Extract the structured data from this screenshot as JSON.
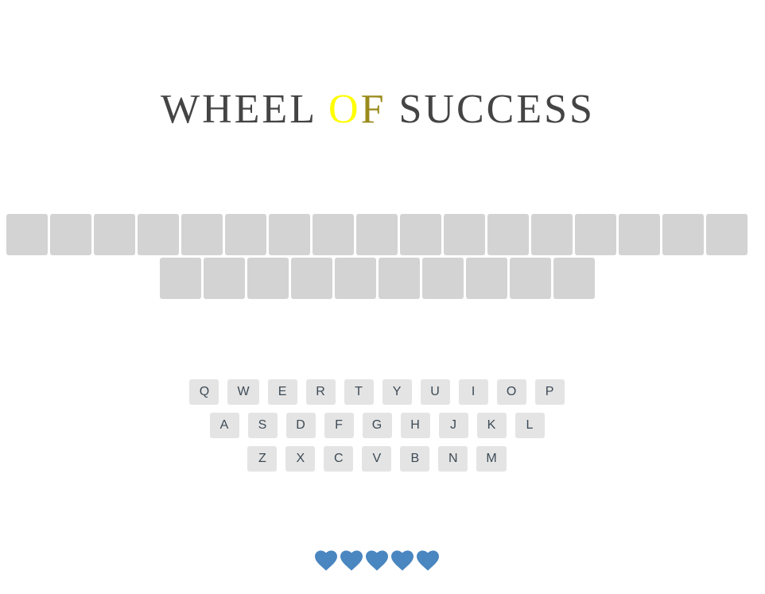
{
  "title": {
    "part1": "WHEEL",
    "o": "O",
    "f": "F",
    "part2": "SUCCESS"
  },
  "board": {
    "rows": [
      17,
      10
    ]
  },
  "keyboard": {
    "rows": [
      [
        "Q",
        "W",
        "E",
        "R",
        "T",
        "Y",
        "U",
        "I",
        "O",
        "P"
      ],
      [
        "A",
        "S",
        "D",
        "F",
        "G",
        "H",
        "J",
        "K",
        "L"
      ],
      [
        "Z",
        "X",
        "C",
        "V",
        "B",
        "N",
        "M"
      ]
    ]
  },
  "lives": {
    "count": 5,
    "color": "#4a86c0",
    "icon": "heart-icon"
  }
}
